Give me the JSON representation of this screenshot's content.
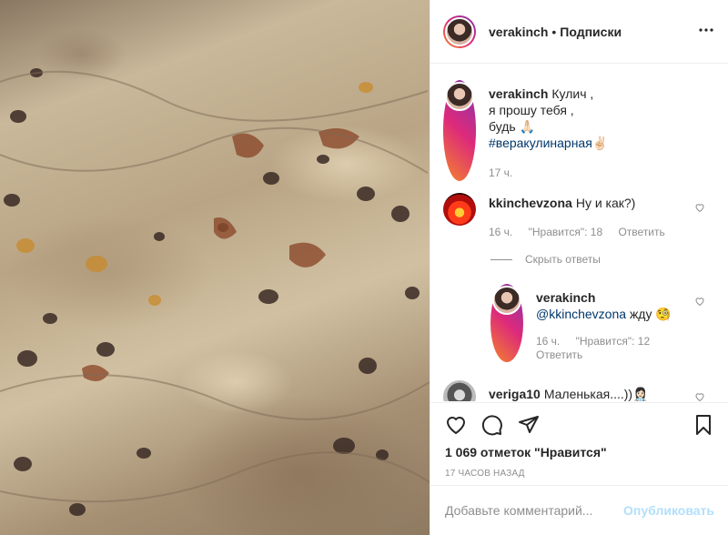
{
  "post": {
    "image_alt": "Kulich dough with raisins and nuts",
    "author": "verakinch",
    "follow_label": "Подписки",
    "separator": "•"
  },
  "caption": {
    "username": "verakinch",
    "line1": "Кулич ,",
    "line2": "я прошу тебя ,",
    "line3": "будь 🙏🏻",
    "hashtag": "#веракулинарная",
    "hashtag_emoji": "✌🏻",
    "time": "17 ч."
  },
  "comments": [
    {
      "username": "kkinchevzona",
      "text": "Ну и как?)",
      "time": "16 ч.",
      "likes": "\"Нравится\": 18",
      "reply": "Ответить"
    }
  ],
  "hide_replies_label": "Скрыть ответы",
  "replies": [
    {
      "username": "verakinch",
      "mention": "@kkinchevzona",
      "text": "жду 🧐",
      "time": "16 ч.",
      "likes": "\"Нравится\": 12",
      "reply": "Ответить"
    }
  ],
  "partial_comment": {
    "username": "veriga10",
    "text": "Маленькая....))👩🏻‍⚕️"
  },
  "likes_count": "1 069 отметок \"Нравится\"",
  "time_ago": "17 часов назад",
  "add_comment": {
    "placeholder": "Добавьте комментарий...",
    "publish_label": "Опубликовать"
  },
  "colors": {
    "link": "#00376b",
    "publish_disabled": "#b2dffc",
    "muted": "#8e8e8e",
    "border": "#efefef"
  }
}
